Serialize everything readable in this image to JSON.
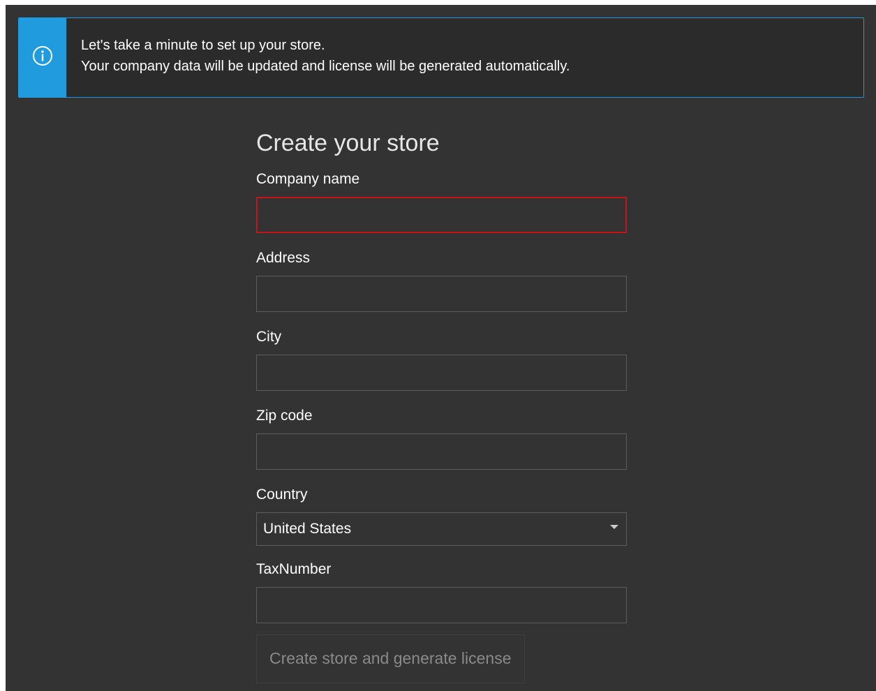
{
  "banner": {
    "icon": "info-circle-icon",
    "line1": "Let's take a minute to set up your store.",
    "line2": "Your company data will be updated and license will be generated automatically."
  },
  "form": {
    "title": "Create your store",
    "fields": {
      "company_name": {
        "label": "Company name",
        "value": "",
        "invalid": true
      },
      "address": {
        "label": "Address",
        "value": ""
      },
      "city": {
        "label": "City",
        "value": ""
      },
      "zip": {
        "label": "Zip code",
        "value": ""
      },
      "country": {
        "label": "Country",
        "value": "United States"
      },
      "tax_number": {
        "label": "TaxNumber",
        "value": ""
      }
    },
    "submit_label": "Create store and generate license"
  },
  "colors": {
    "background": "#333333",
    "accent": "#1f9bde",
    "error": "#c4141c"
  }
}
